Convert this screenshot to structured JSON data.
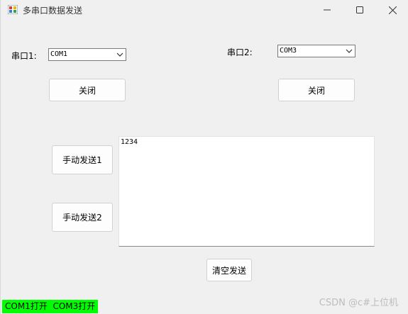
{
  "window": {
    "title": "多串口数据发送"
  },
  "port1": {
    "label": "串口1:",
    "selected": "COM1",
    "toggle_button": "关闭"
  },
  "port2": {
    "label": "串口2:",
    "selected": "COM3",
    "toggle_button": "关闭"
  },
  "send": {
    "manual1": "手动发送1",
    "manual2": "手动发送2",
    "clear": "清空发送",
    "text": "1234"
  },
  "status": {
    "text": "COM1打开  COM3打开",
    "highlight_color": "#00ff00"
  },
  "watermark": "CSDN @c#上位机"
}
